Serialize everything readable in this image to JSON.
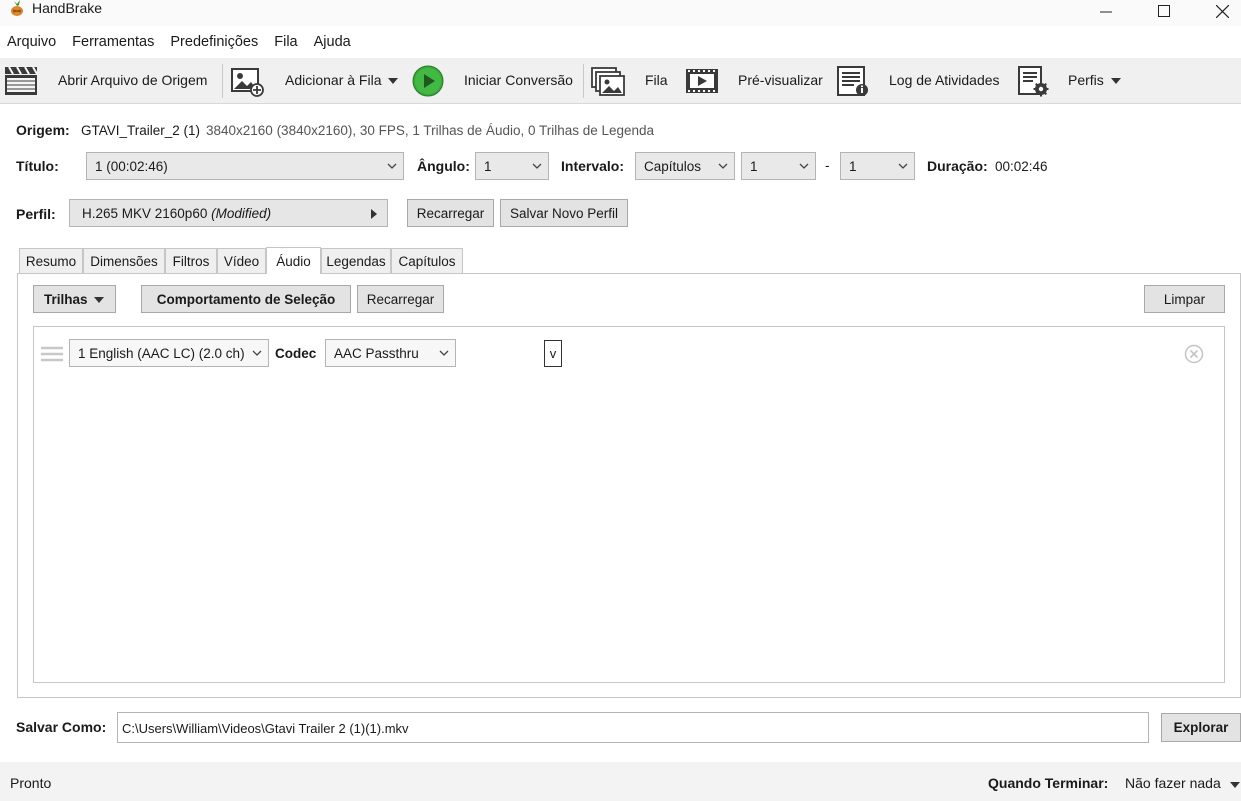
{
  "window": {
    "title": "HandBrake",
    "logo_icon": "handbrake-pineapple-icon"
  },
  "menu": [
    "Arquivo",
    "Ferramentas",
    "Predefinições",
    "Fila",
    "Ajuda"
  ],
  "toolbar": {
    "open_source": "Abrir Arquivo de Origem",
    "add_queue": "Adicionar à Fila",
    "start": "Iniciar Conversão",
    "queue": "Fila",
    "preview": "Pré-visualizar",
    "activity_log": "Log de Atividades",
    "profiles": "Perfis"
  },
  "source": {
    "label": "Origem:",
    "name": "GTAVI_Trailer_2 (1)",
    "info": "3840x2160 (3840x2160), 30 FPS, 1 Trilhas de Áudio, 0 Trilhas de Legenda"
  },
  "title_row": {
    "title_label": "Título:",
    "title_value": "1  (00:02:46)",
    "angle_label": "Ângulo:",
    "angle_value": "1",
    "range_label": "Intervalo:",
    "range_type": "Capítulos",
    "range_start": "1",
    "range_sep": "-",
    "range_end": "1",
    "duration_label": "Duração:",
    "duration_value": "00:02:46"
  },
  "profile_row": {
    "label": "Perfil:",
    "value": "H.265 MKV 2160p60",
    "modified": "(Modified)",
    "reload": "Recarregar",
    "save_new": "Salvar Novo Perfil"
  },
  "tabs": [
    "Resumo",
    "Dimensões",
    "Filtros",
    "Vídeo",
    "Áudio",
    "Legendas",
    "Capítulos"
  ],
  "active_tab": "Áudio",
  "audio": {
    "tracks_button": "Trilhas",
    "selection_behavior": "Comportamento de Seleção",
    "reload": "Recarregar",
    "clear": "Limpar",
    "track": {
      "source": "1 English (AAC LC) (2.0 ch)",
      "codec_label": "Codec",
      "codec_value": "AAC Passthru",
      "extra_box": "v"
    }
  },
  "save_as": {
    "label": "Salvar Como:",
    "path": "C:\\Users\\William\\Videos\\Gtavi Trailer 2 (1)(1).mkv",
    "browse": "Explorar"
  },
  "status": {
    "text": "Pronto",
    "when_done_label": "Quando Terminar:",
    "when_done_value": "Não fazer nada"
  },
  "colors": {
    "toolbar_bg": "#f0f0f0",
    "play_green": "#3aa83a",
    "button_bg": "#e3e3e3"
  }
}
